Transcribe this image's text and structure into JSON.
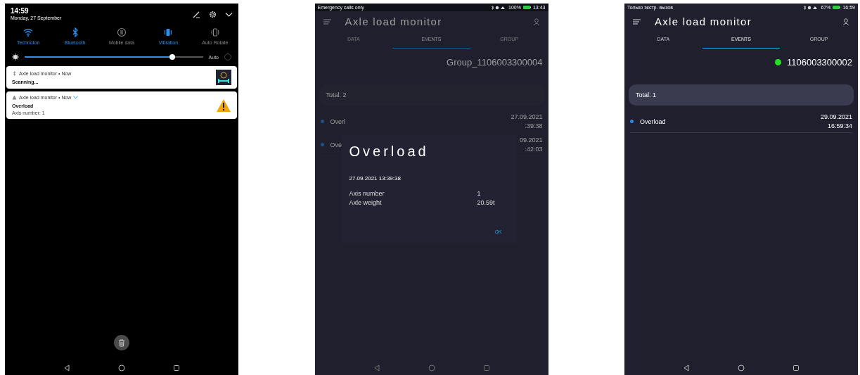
{
  "notification_shade": {
    "time": "14:59",
    "date": "Monday, 27 September",
    "toggles": [
      {
        "label": "Technoton",
        "kind": "wifi",
        "on": true
      },
      {
        "label": "Bluetooth",
        "kind": "bluetooth",
        "on": true
      },
      {
        "label": "Mobile data",
        "kind": "data",
        "on": false
      },
      {
        "label": "Vibration",
        "kind": "vibration",
        "on": true
      },
      {
        "label": "Auto Rotate",
        "kind": "rotate",
        "on": false
      }
    ],
    "brightness": {
      "level": 0.83,
      "auto_label": "Auto",
      "auto_checked": false
    },
    "notifications": [
      {
        "app": "Axle load monitor • Now",
        "kind": "scanning",
        "title": "Scanning...",
        "expandable": false
      },
      {
        "app": "Axle load monitor • Now",
        "kind": "warning",
        "title": "Overload",
        "text": "Axis number: 1",
        "expandable": true
      }
    ]
  },
  "app_screens": [
    {
      "status_left": "Emergency calls only",
      "battery": "100%",
      "clock": "13:43",
      "title": "Axle load monitor",
      "tabs": [
        {
          "label": "DATA",
          "selected": false
        },
        {
          "label": "EVENTS",
          "selected": true
        },
        {
          "label": "GROUP",
          "selected": false
        }
      ],
      "device": {
        "name": "Group_1106003300004",
        "online": false
      },
      "total": "Total: 2",
      "events": [
        {
          "name": "Overl",
          "date": "27.09.2021",
          "time": ":39:38"
        },
        {
          "name": "Ove",
          "date": "09.2021",
          "time": ":42:03"
        }
      ],
      "dialog": {
        "title": "Overload",
        "datetime": "27.09.2021 13:39:38",
        "rows": [
          {
            "label": "Axis number",
            "value": "1"
          },
          {
            "label": "Axle weight",
            "value": "20.59t"
          }
        ],
        "button": "OK"
      }
    },
    {
      "status_left": "Только экстр. вызов",
      "battery": "67%",
      "clock": "16:59",
      "title": "Axle load monitor",
      "tabs": [
        {
          "label": "DATA",
          "selected": false
        },
        {
          "label": "EVENTS",
          "selected": true
        },
        {
          "label": "GROUP",
          "selected": false
        }
      ],
      "device": {
        "name": "1106003300002",
        "online": true
      },
      "total": "Total: 1",
      "events": [
        {
          "name": "Overload",
          "date": "29.09.2021",
          "time": "16:59:34"
        }
      ]
    }
  ]
}
